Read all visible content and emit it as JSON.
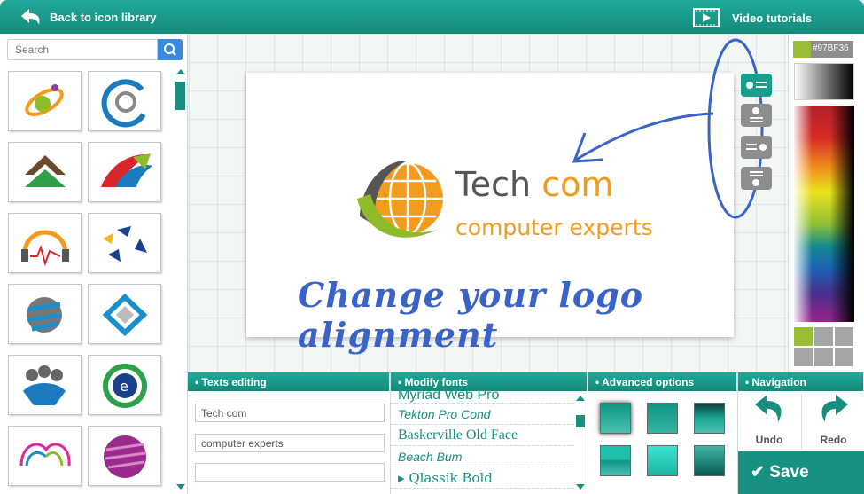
{
  "header": {
    "back_label": "Back to icon library",
    "video_label": "Video tutorials"
  },
  "search": {
    "placeholder": "Search"
  },
  "logo": {
    "word1": "Tech",
    "word2": "com",
    "tagline": "computer experts"
  },
  "annotation": "Change your logo alignment",
  "color": {
    "hex": "#97BF36",
    "accent": "#1a9e8c"
  },
  "panels": {
    "texts": {
      "title": "Texts editing",
      "fields": [
        "Tech com",
        "computer experts",
        ""
      ]
    },
    "fonts": {
      "title": "Modify fonts",
      "items": [
        "Myriad Web Pro",
        "Tekton Pro Cond",
        "Baskerville Old Face",
        "Beach Bum",
        "Qlassik Bold"
      ]
    },
    "advanced": {
      "title": "Advanced options"
    },
    "navigation": {
      "title": "Navigation",
      "undo": "Undo",
      "redo": "Redo",
      "save": "Save"
    }
  }
}
